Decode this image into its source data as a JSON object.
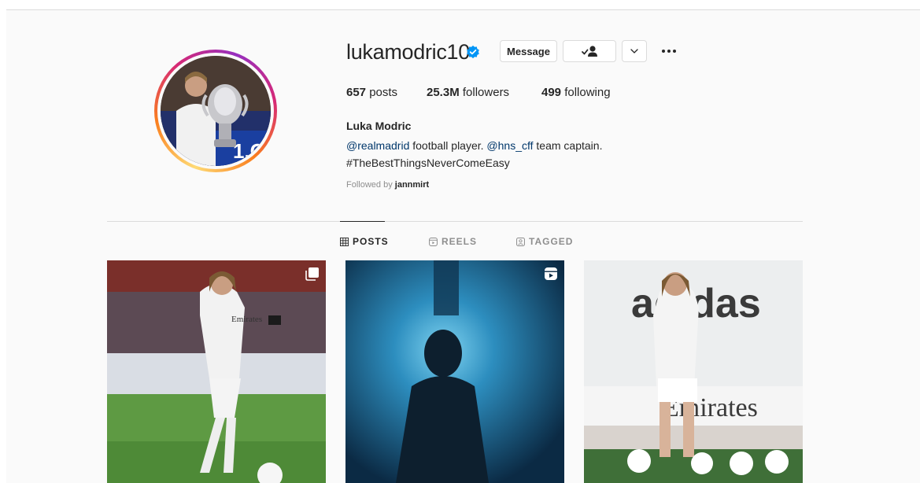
{
  "profile": {
    "username": "lukamodric10",
    "full_name": "Luka Modric",
    "stats": {
      "posts_count": "657",
      "posts_label": "posts",
      "followers_count": "25.3M",
      "followers_label": "followers",
      "following_count": "499",
      "following_label": "following"
    },
    "bio": {
      "mention1": "@realmadrid",
      "text1": " football player. ",
      "mention2": "@hns_cff",
      "text2": " team captain.",
      "line2": "#TheBestThingsNeverComeEasy"
    },
    "followed_by_prefix": "Followed by ",
    "followed_by_user": "jannmirt"
  },
  "actions": {
    "message_label": "Message"
  },
  "tabs": [
    {
      "label": "POSTS",
      "active": true
    },
    {
      "label": "REELS",
      "active": false
    },
    {
      "label": "TAGGED",
      "active": false
    }
  ],
  "posts": [
    {
      "type": "carousel",
      "icon": "carousel-icon"
    },
    {
      "type": "reel",
      "icon": "reel-icon"
    },
    {
      "type": "photo",
      "icon": ""
    }
  ],
  "colors": {
    "verified": "#0095f6",
    "link": "#00376b",
    "muted": "#8e8e8e"
  }
}
